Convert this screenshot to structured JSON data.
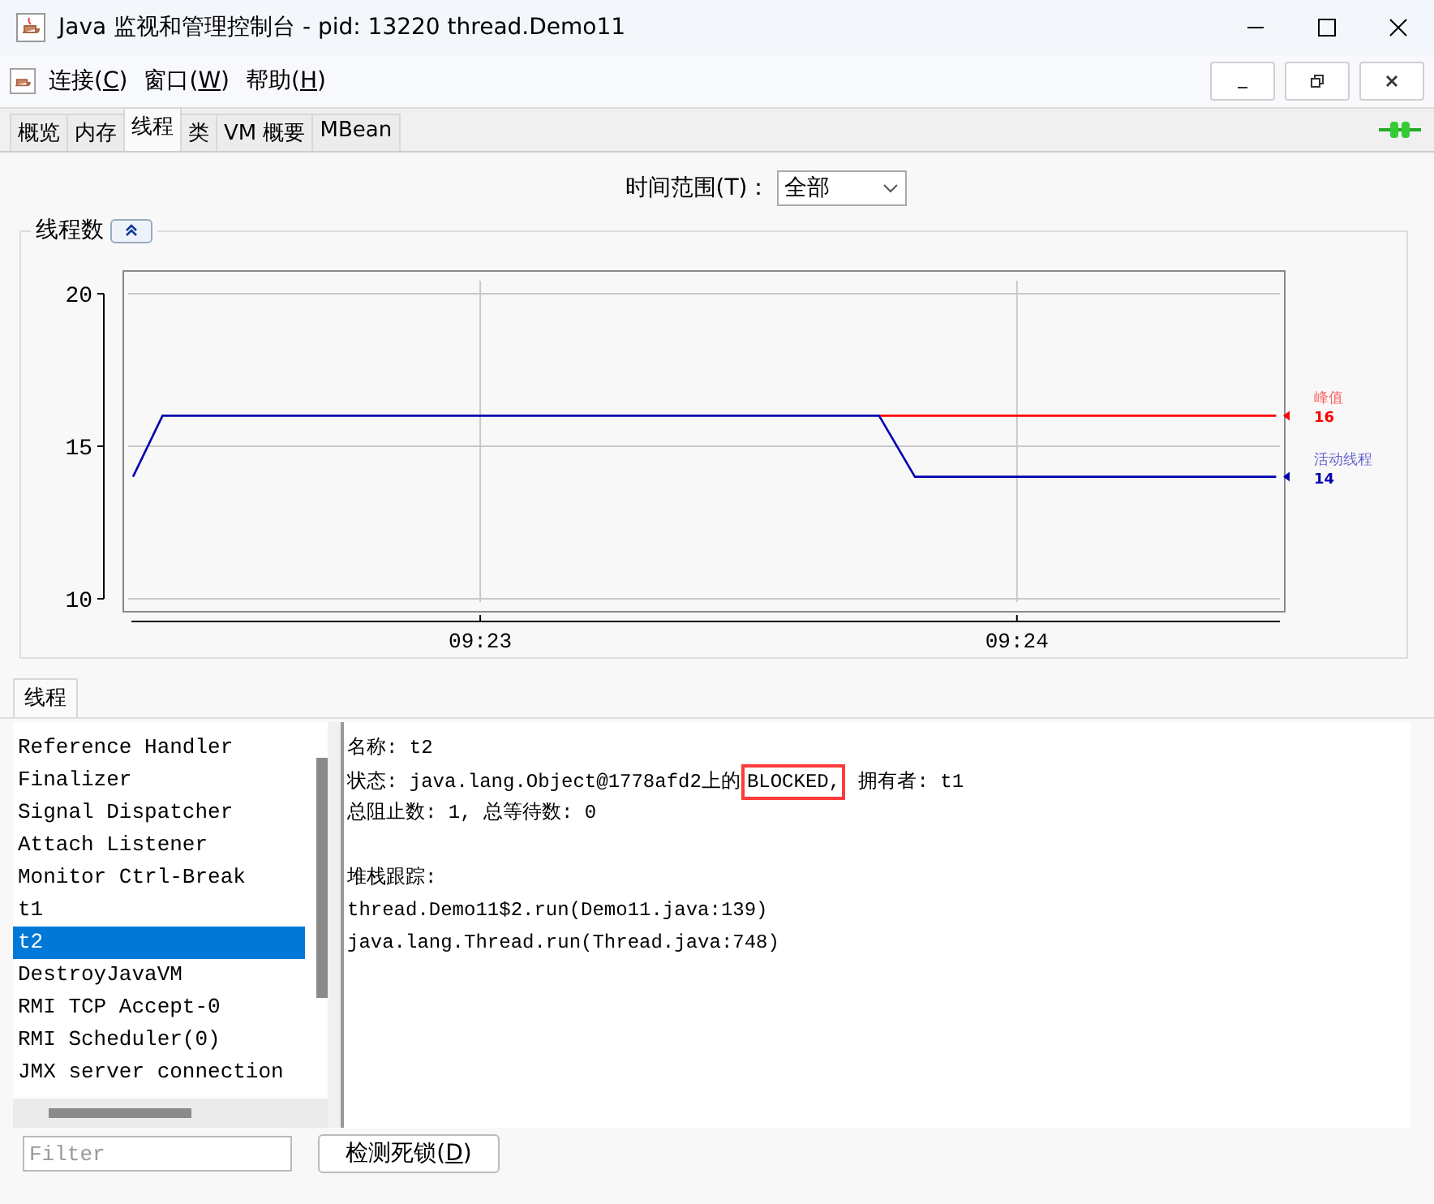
{
  "window": {
    "title": "Java 监视和管理控制台 - pid: 13220 thread.Demo11"
  },
  "menu": [
    {
      "label": "连接(C)"
    },
    {
      "label": "窗口(W)"
    },
    {
      "label": "帮助(H)"
    }
  ],
  "tabs": [
    {
      "label": "概览",
      "selected": false
    },
    {
      "label": "内存",
      "selected": false
    },
    {
      "label": "线程",
      "selected": true
    },
    {
      "label": "类",
      "selected": false
    },
    {
      "label": "VM 概要",
      "selected": false
    },
    {
      "label": "MBean",
      "selected": false
    }
  ],
  "time_range": {
    "label": "时间范围(T)：",
    "value": "全部"
  },
  "chart": {
    "title": "线程数",
    "readings": [
      "16",
      "14"
    ],
    "chart_data": {
      "type": "line",
      "x": [
        562.353,
        562.408,
        563.743,
        563.81,
        564.483
      ],
      "series": [
        {
          "name": "峰值",
          "color": "#ff0000",
          "values": [
            null,
            null,
            16,
            16,
            16
          ]
        },
        {
          "name": "活动线程",
          "color": "#0000b0",
          "values": [
            14,
            16,
            16,
            14,
            14
          ]
        }
      ],
      "grid": true,
      "xlim": [
        562.35,
        564.49
      ],
      "ylim": [
        10,
        20
      ],
      "yticks": [
        10,
        15,
        20
      ],
      "xticks": [
        {
          "value": 563,
          "label": "09:23"
        },
        {
          "value": 564,
          "label": "09:24"
        }
      ]
    }
  },
  "lower_tab": {
    "label": "线程",
    "selected": true
  },
  "threads": [
    {
      "name": "Reference Handler",
      "selected": false
    },
    {
      "name": "Finalizer",
      "selected": false
    },
    {
      "name": "Signal Dispatcher",
      "selected": false
    },
    {
      "name": "Attach Listener",
      "selected": false
    },
    {
      "name": "Monitor Ctrl-Break",
      "selected": false
    },
    {
      "name": "t1",
      "selected": false
    },
    {
      "name": "t2",
      "selected": true
    },
    {
      "name": "DestroyJavaVM",
      "selected": false
    },
    {
      "name": "RMI TCP Accept-0",
      "selected": false
    },
    {
      "name": "RMI Scheduler(0)",
      "selected": false
    },
    {
      "name": "JMX server connection",
      "selected": false
    }
  ],
  "details": [
    {
      "kind": "text",
      "text": "名称: t2"
    },
    {
      "kind": "state",
      "before": "状态: java.lang.Object@1778afd2上的",
      "highlighted": "BLOCKED,",
      "after": " 拥有者: t1"
    },
    {
      "kind": "text",
      "text": "总阻止数: 1, 总等待数: 0"
    },
    {
      "kind": "blank"
    },
    {
      "kind": "text",
      "text": "堆栈跟踪:"
    },
    {
      "kind": "text",
      "text": "thread.Demo11$2.run(Demo11.java:139)"
    },
    {
      "kind": "text",
      "text": "java.lang.Thread.run(Thread.java:748)"
    }
  ],
  "filter": {
    "placeholder": "Filter"
  },
  "deadlock_button": {
    "label": "检测死锁(D)"
  }
}
